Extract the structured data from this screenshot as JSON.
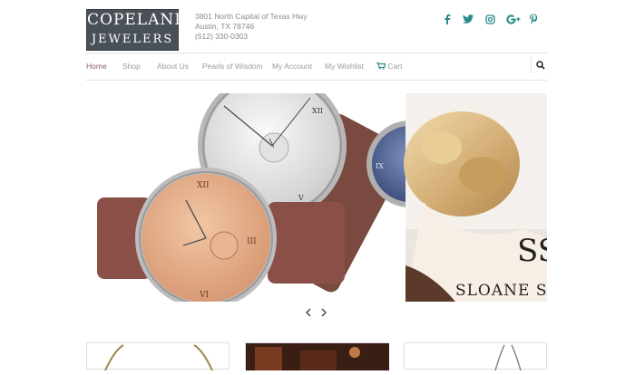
{
  "brand": {
    "line1": "COPELAND",
    "line2": "JEWELERS"
  },
  "address": {
    "line1": "3801 North Capital of Texas Hwy",
    "line2": "Austin, TX 78746",
    "line3": "(512) 330-0303"
  },
  "social": [
    "facebook-icon",
    "twitter-icon",
    "instagram-icon",
    "google-plus-icon",
    "pinterest-icon"
  ],
  "nav": {
    "items": [
      "Home",
      "Shop",
      "About Us",
      "Pearls of Wisdom",
      "My Account",
      "My Wishlist",
      "Cart"
    ]
  },
  "hero": {
    "brand_text": "SLOANE S",
    "monogram": "SS"
  },
  "colors": {
    "accent": "#2a8a8d",
    "active": "#8a5a7a",
    "logo_bg": "#495057"
  }
}
